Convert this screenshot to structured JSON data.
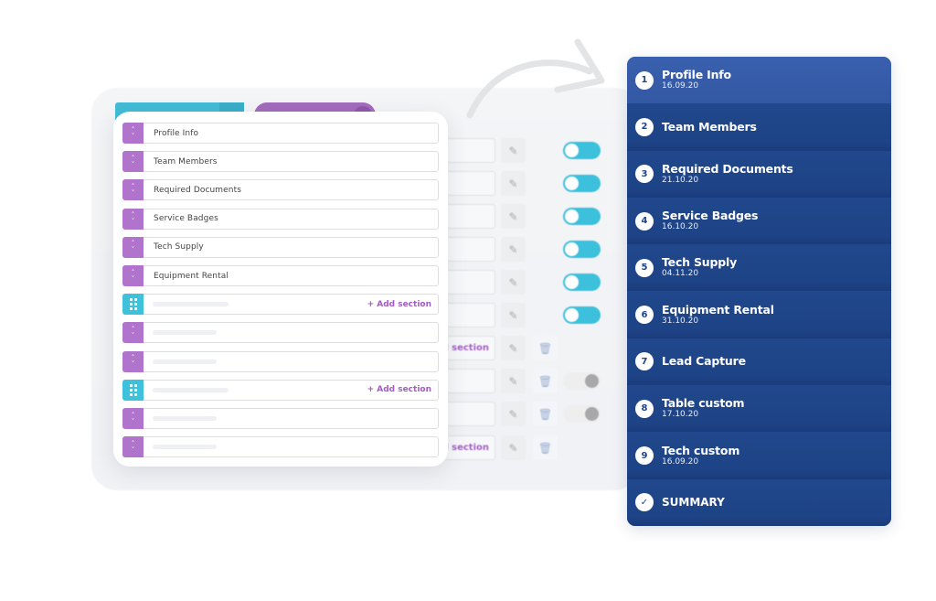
{
  "background": {
    "tabs": [
      {
        "color": "#42bcd6"
      },
      {
        "color": "#a36bbd"
      }
    ],
    "rows": [
      {
        "field_text": "",
        "toggle": "on",
        "trash": false
      },
      {
        "field_text": "",
        "toggle": "on",
        "trash": false
      },
      {
        "field_text": "",
        "toggle": "on",
        "trash": false
      },
      {
        "field_text": "",
        "toggle": "on",
        "trash": false
      },
      {
        "field_text": "",
        "toggle": "on",
        "trash": false
      },
      {
        "field_text": "",
        "toggle": "on",
        "trash": false
      },
      {
        "field_text": "d section",
        "toggle": null,
        "trash": true
      },
      {
        "field_text": "",
        "toggle": "off",
        "trash": true
      },
      {
        "field_text": "",
        "toggle": "off",
        "trash": true
      },
      {
        "field_text": "d section",
        "toggle": null,
        "trash": true
      }
    ]
  },
  "sections_editor": {
    "rows": [
      {
        "type": "section",
        "label": "Profile Info"
      },
      {
        "type": "section",
        "label": "Team Members"
      },
      {
        "type": "section",
        "label": "Required Documents"
      },
      {
        "type": "section",
        "label": "Service Badges"
      },
      {
        "type": "section",
        "label": "Tech Supply"
      },
      {
        "type": "section",
        "label": "Equipment Rental"
      },
      {
        "type": "group",
        "label": "",
        "action": "+ Add section"
      },
      {
        "type": "section",
        "label": ""
      },
      {
        "type": "section",
        "label": ""
      },
      {
        "type": "group",
        "label": "",
        "action": "+ Add section"
      },
      {
        "type": "section",
        "label": ""
      },
      {
        "type": "section",
        "label": ""
      }
    ]
  },
  "steps_panel": {
    "steps": [
      {
        "num": "1",
        "title": "Profile Info",
        "date": "16.09.20",
        "active": true
      },
      {
        "num": "2",
        "title": "Team Members",
        "date": ""
      },
      {
        "num": "3",
        "title": "Required Documents",
        "date": "21.10.20"
      },
      {
        "num": "4",
        "title": "Service Badges",
        "date": "16.10.20"
      },
      {
        "num": "5",
        "title": "Tech Supply",
        "date": "04.11.20"
      },
      {
        "num": "6",
        "title": "Equipment Rental",
        "date": "31.10.20"
      },
      {
        "num": "7",
        "title": "Lead Capture",
        "date": ""
      },
      {
        "num": "8",
        "title": "Table custom",
        "date": "17.10.20"
      },
      {
        "num": "9",
        "title": "Tech custom",
        "date": "16.09.20"
      },
      {
        "num": "✓",
        "title": "SUMMARY",
        "date": "",
        "summary": true
      }
    ],
    "colors": {
      "panel": "#1f4589",
      "active": "#3358a4"
    }
  },
  "icons": {
    "handle_arrows": "chevron-up-down-icon",
    "handle_grid": "drag-grip-icon",
    "edit": "pencil-icon",
    "delete": "trash-icon",
    "summary": "check-icon",
    "flow": "curved-arrow-icon"
  }
}
